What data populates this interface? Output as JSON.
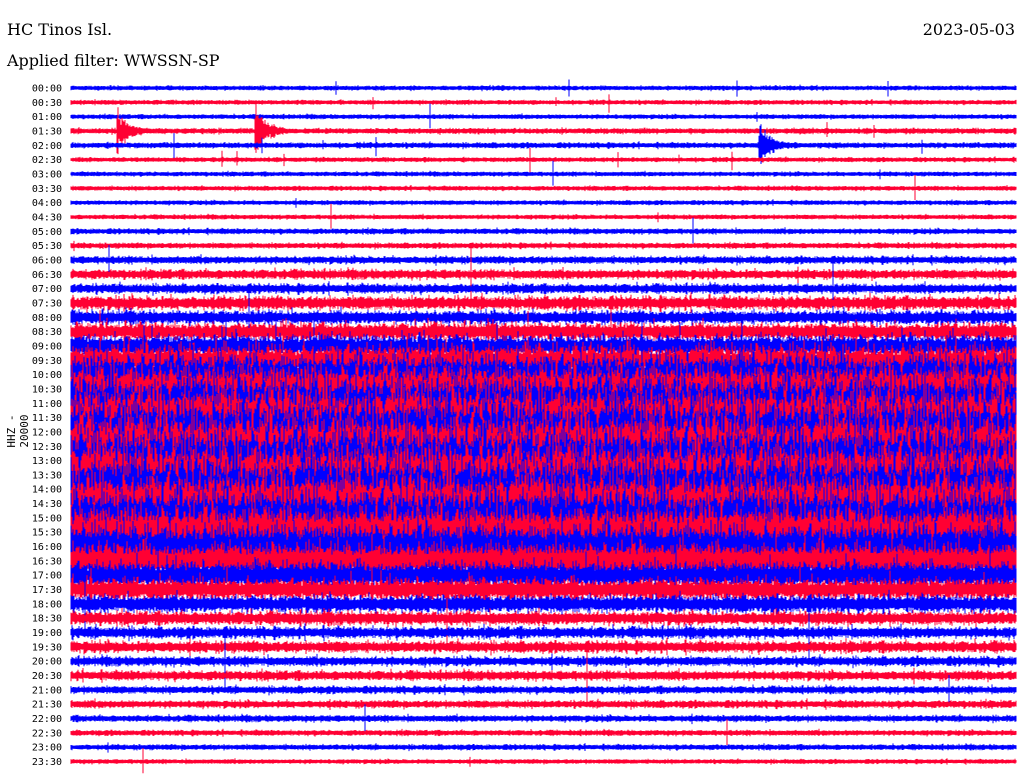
{
  "header": {
    "station": "HC Tinos Isl.",
    "filter": "Applied filter: WWSSN-SP",
    "date": "2023-05-03"
  },
  "chart_data": {
    "type": "line",
    "title": "HC Tinos Isl.",
    "subtitle": "Applied filter: WWSSN-SP",
    "ylabel": "HHZ - 20000",
    "xlabel": "",
    "colors": [
      "#0000ff",
      "#ff0033"
    ],
    "row_labels": [
      "00:00",
      "00:30",
      "01:00",
      "01:30",
      "02:00",
      "02:30",
      "03:00",
      "03:30",
      "04:00",
      "04:30",
      "05:00",
      "05:30",
      "06:00",
      "06:30",
      "07:00",
      "07:30",
      "08:00",
      "08:30",
      "09:00",
      "09:30",
      "10:00",
      "10:30",
      "11:00",
      "11:30",
      "12:00",
      "12:30",
      "13:00",
      "13:30",
      "14:00",
      "14:30",
      "15:00",
      "15:30",
      "16:00",
      "16:30",
      "17:00",
      "17:30",
      "18:00",
      "18:30",
      "19:00",
      "19:30",
      "20:00",
      "20:30",
      "21:00",
      "21:30",
      "22:00",
      "22:30",
      "23:00",
      "23:30"
    ],
    "relative_amplitude": [
      1.5,
      1.5,
      1.5,
      2,
      2,
      1.5,
      1.5,
      1.5,
      1.5,
      1.5,
      2,
      2,
      3,
      4,
      4,
      6,
      6,
      8,
      10,
      14,
      18,
      22,
      25,
      28,
      30,
      30,
      30,
      30,
      30,
      28,
      26,
      24,
      20,
      16,
      12,
      10,
      8,
      6,
      5,
      5,
      4,
      4,
      3,
      3,
      2.5,
      2,
      2,
      1.5
    ],
    "events": [
      {
        "row": 3,
        "minute": 1.5,
        "amplitude": 25
      },
      {
        "row": 3,
        "minute": 5.9,
        "amplitude": 30
      },
      {
        "row": 4,
        "minute": 21.9,
        "amplitude": 25
      }
    ]
  }
}
